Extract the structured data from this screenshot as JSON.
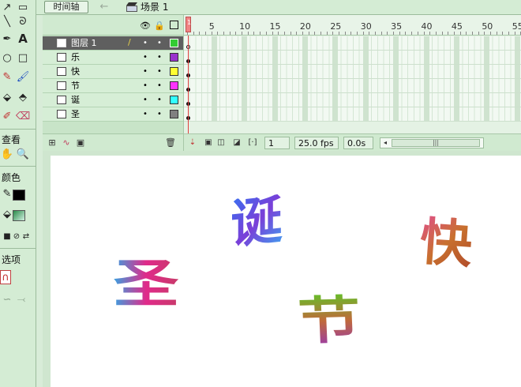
{
  "scene_bar": {
    "timeline_button": "时间轴",
    "scene_name": "场景 1"
  },
  "tools": {
    "view_label": "查看",
    "colors_label": "颜色",
    "options_label": "选项",
    "text_tool": "A"
  },
  "timeline": {
    "ruler_numbers": [
      "5",
      "10",
      "15",
      "20",
      "25",
      "30",
      "35",
      "40",
      "45",
      "50",
      "55"
    ],
    "playhead_frame": "1",
    "layers": [
      {
        "name": "图层 1",
        "selected": true,
        "color": "#33cc33"
      },
      {
        "name": "乐",
        "selected": false,
        "color": "#9933cc"
      },
      {
        "name": "快",
        "selected": false,
        "color": "#ffff33"
      },
      {
        "name": "节",
        "selected": false,
        "color": "#ff33ff"
      },
      {
        "name": "诞",
        "selected": false,
        "color": "#33ffff"
      },
      {
        "name": "圣",
        "selected": false,
        "color": "#808080"
      }
    ],
    "status": {
      "frame": "1",
      "fps": "25.0 fps",
      "time": "0.0s"
    }
  },
  "stage": {
    "glyphs": [
      {
        "char": "诞",
        "gradient": "linear-gradient(135deg,#3a6ff0,#7a3fd8,#3fa0f0)"
      },
      {
        "char": "快",
        "gradient": "linear-gradient(135deg,#e0508a,#c8702e,#b04a2a)"
      },
      {
        "char": "圣",
        "gradient": "linear-gradient(90deg,#3aa0e0,#e02a8a,#c83a6a)"
      },
      {
        "char": "节",
        "gradient": "linear-gradient(180deg,#6aba2a,#c06a3a,#9a3aaa)"
      }
    ]
  }
}
